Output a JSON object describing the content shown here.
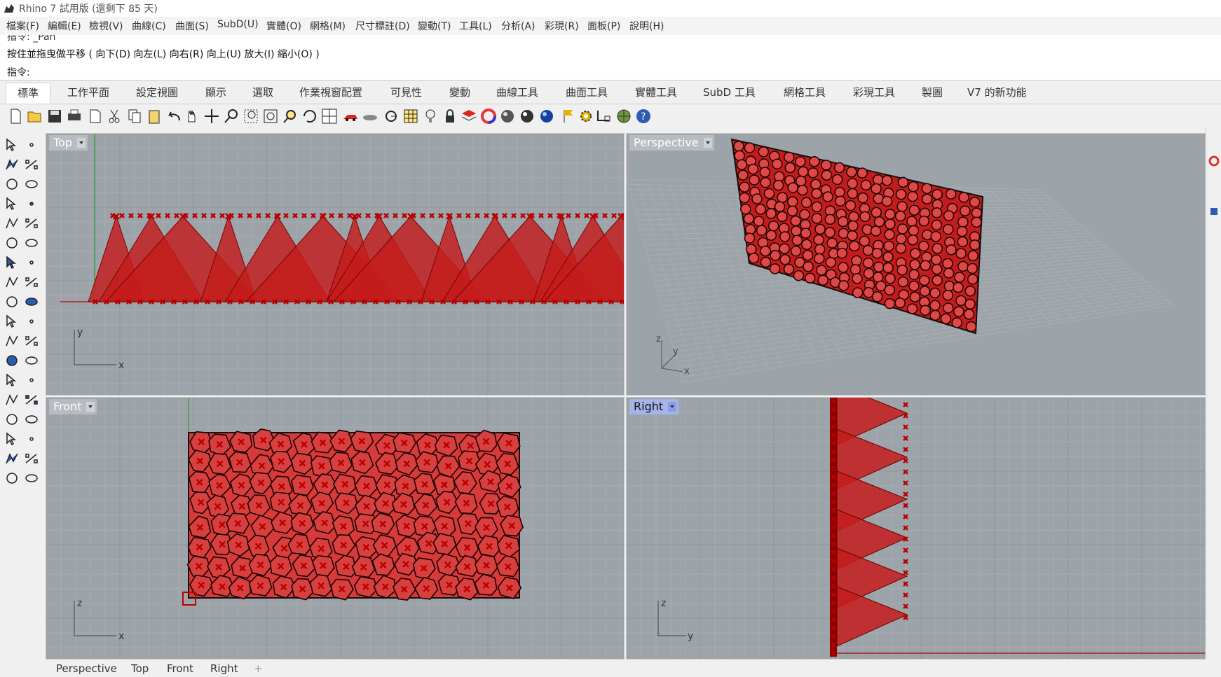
{
  "window": {
    "title": "Rhino 7 試用版 (還剩下 85 天)"
  },
  "menu": [
    "檔案(F)",
    "編輯(E)",
    "檢視(V)",
    "曲線(C)",
    "曲面(S)",
    "SubD(U)",
    "實體(O)",
    "網格(M)",
    "尺寸標註(D)",
    "變動(T)",
    "工具(L)",
    "分析(A)",
    "彩現(R)",
    "面板(P)",
    "說明(H)"
  ],
  "command": {
    "history_partial": "指令: _Pan",
    "prompt_line": "按住並拖曳做平移 ( 向下(D)  向左(L)  向右(R)  向上(U)  放大(I)  縮小(O) )",
    "label": "指令:",
    "value": ""
  },
  "toolbar_tabs": [
    "標準",
    "工作平面",
    "設定視圖",
    "顯示",
    "選取",
    "作業視窗配置",
    "可見性",
    "變動",
    "曲線工具",
    "曲面工具",
    "實體工具",
    "SubD 工具",
    "網格工具",
    "彩現工具",
    "製圖",
    "V7 的新功能"
  ],
  "active_tab": "標準",
  "toolbar_icons": [
    "new-icon",
    "open-icon",
    "save-icon",
    "print-icon",
    "import-icon",
    "cut-icon",
    "copy-icon",
    "paste-icon",
    "undo-icon",
    "pan-icon",
    "move-view-icon",
    "zoom-icon",
    "zoom-window-icon",
    "zoom-extents-icon",
    "zoom-selected-icon",
    "rotate-view-icon",
    "four-viewports-icon",
    "car-icon",
    "plane-icon",
    "circle-select-icon",
    "grid-icon",
    "light-icon",
    "lock-icon",
    "layer-icon",
    "color-wheel-icon",
    "shaded-sphere-icon",
    "rendered-sphere-icon",
    "blue-sphere-icon",
    "flag-icon",
    "gear-icon",
    "dimension-icon",
    "globe-icon",
    "help-icon"
  ],
  "viewports": {
    "top": {
      "label": "Top",
      "axis_a": "y",
      "axis_b": "x"
    },
    "perspective": {
      "label": "Perspective",
      "axis_a": "z",
      "axis_b": "y",
      "axis_c": "x"
    },
    "front": {
      "label": "Front",
      "axis_a": "z",
      "axis_b": "x"
    },
    "right": {
      "label": "Right",
      "axis_a": "z",
      "axis_b": "y"
    }
  },
  "active_viewport": "Right",
  "bottom_tabs": [
    "Perspective",
    "Top",
    "Front",
    "Right"
  ],
  "colors": {
    "viewport_bg": "#9ca3a9",
    "grid_minor": "#a8aeb3",
    "grid_major": "#8e959b",
    "object_red": "#c41c1c",
    "active_title": "#a6b4ea"
  }
}
